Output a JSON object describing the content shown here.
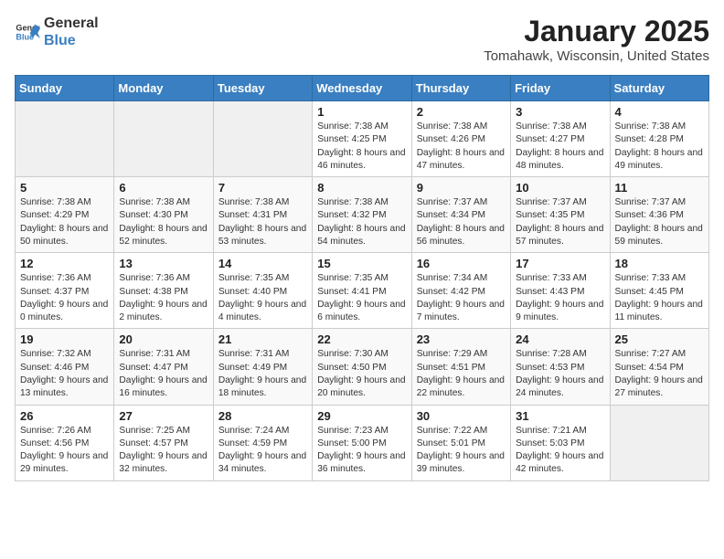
{
  "header": {
    "logo": {
      "general": "General",
      "blue": "Blue"
    },
    "title": "January 2025",
    "location": "Tomahawk, Wisconsin, United States"
  },
  "weekdays": [
    "Sunday",
    "Monday",
    "Tuesday",
    "Wednesday",
    "Thursday",
    "Friday",
    "Saturday"
  ],
  "weeks": [
    [
      {
        "day": "",
        "empty": true
      },
      {
        "day": "",
        "empty": true
      },
      {
        "day": "",
        "empty": true
      },
      {
        "day": "1",
        "sunrise": "7:38 AM",
        "sunset": "4:25 PM",
        "daylight": "8 hours and 46 minutes."
      },
      {
        "day": "2",
        "sunrise": "7:38 AM",
        "sunset": "4:26 PM",
        "daylight": "8 hours and 47 minutes."
      },
      {
        "day": "3",
        "sunrise": "7:38 AM",
        "sunset": "4:27 PM",
        "daylight": "8 hours and 48 minutes."
      },
      {
        "day": "4",
        "sunrise": "7:38 AM",
        "sunset": "4:28 PM",
        "daylight": "8 hours and 49 minutes."
      }
    ],
    [
      {
        "day": "5",
        "sunrise": "7:38 AM",
        "sunset": "4:29 PM",
        "daylight": "8 hours and 50 minutes."
      },
      {
        "day": "6",
        "sunrise": "7:38 AM",
        "sunset": "4:30 PM",
        "daylight": "8 hours and 52 minutes."
      },
      {
        "day": "7",
        "sunrise": "7:38 AM",
        "sunset": "4:31 PM",
        "daylight": "8 hours and 53 minutes."
      },
      {
        "day": "8",
        "sunrise": "7:38 AM",
        "sunset": "4:32 PM",
        "daylight": "8 hours and 54 minutes."
      },
      {
        "day": "9",
        "sunrise": "7:37 AM",
        "sunset": "4:34 PM",
        "daylight": "8 hours and 56 minutes."
      },
      {
        "day": "10",
        "sunrise": "7:37 AM",
        "sunset": "4:35 PM",
        "daylight": "8 hours and 57 minutes."
      },
      {
        "day": "11",
        "sunrise": "7:37 AM",
        "sunset": "4:36 PM",
        "daylight": "8 hours and 59 minutes."
      }
    ],
    [
      {
        "day": "12",
        "sunrise": "7:36 AM",
        "sunset": "4:37 PM",
        "daylight": "9 hours and 0 minutes."
      },
      {
        "day": "13",
        "sunrise": "7:36 AM",
        "sunset": "4:38 PM",
        "daylight": "9 hours and 2 minutes."
      },
      {
        "day": "14",
        "sunrise": "7:35 AM",
        "sunset": "4:40 PM",
        "daylight": "9 hours and 4 minutes."
      },
      {
        "day": "15",
        "sunrise": "7:35 AM",
        "sunset": "4:41 PM",
        "daylight": "9 hours and 6 minutes."
      },
      {
        "day": "16",
        "sunrise": "7:34 AM",
        "sunset": "4:42 PM",
        "daylight": "9 hours and 7 minutes."
      },
      {
        "day": "17",
        "sunrise": "7:33 AM",
        "sunset": "4:43 PM",
        "daylight": "9 hours and 9 minutes."
      },
      {
        "day": "18",
        "sunrise": "7:33 AM",
        "sunset": "4:45 PM",
        "daylight": "9 hours and 11 minutes."
      }
    ],
    [
      {
        "day": "19",
        "sunrise": "7:32 AM",
        "sunset": "4:46 PM",
        "daylight": "9 hours and 13 minutes."
      },
      {
        "day": "20",
        "sunrise": "7:31 AM",
        "sunset": "4:47 PM",
        "daylight": "9 hours and 16 minutes."
      },
      {
        "day": "21",
        "sunrise": "7:31 AM",
        "sunset": "4:49 PM",
        "daylight": "9 hours and 18 minutes."
      },
      {
        "day": "22",
        "sunrise": "7:30 AM",
        "sunset": "4:50 PM",
        "daylight": "9 hours and 20 minutes."
      },
      {
        "day": "23",
        "sunrise": "7:29 AM",
        "sunset": "4:51 PM",
        "daylight": "9 hours and 22 minutes."
      },
      {
        "day": "24",
        "sunrise": "7:28 AM",
        "sunset": "4:53 PM",
        "daylight": "9 hours and 24 minutes."
      },
      {
        "day": "25",
        "sunrise": "7:27 AM",
        "sunset": "4:54 PM",
        "daylight": "9 hours and 27 minutes."
      }
    ],
    [
      {
        "day": "26",
        "sunrise": "7:26 AM",
        "sunset": "4:56 PM",
        "daylight": "9 hours and 29 minutes."
      },
      {
        "day": "27",
        "sunrise": "7:25 AM",
        "sunset": "4:57 PM",
        "daylight": "9 hours and 32 minutes."
      },
      {
        "day": "28",
        "sunrise": "7:24 AM",
        "sunset": "4:59 PM",
        "daylight": "9 hours and 34 minutes."
      },
      {
        "day": "29",
        "sunrise": "7:23 AM",
        "sunset": "5:00 PM",
        "daylight": "9 hours and 36 minutes."
      },
      {
        "day": "30",
        "sunrise": "7:22 AM",
        "sunset": "5:01 PM",
        "daylight": "9 hours and 39 minutes."
      },
      {
        "day": "31",
        "sunrise": "7:21 AM",
        "sunset": "5:03 PM",
        "daylight": "9 hours and 42 minutes."
      },
      {
        "day": "",
        "empty": true
      }
    ]
  ]
}
